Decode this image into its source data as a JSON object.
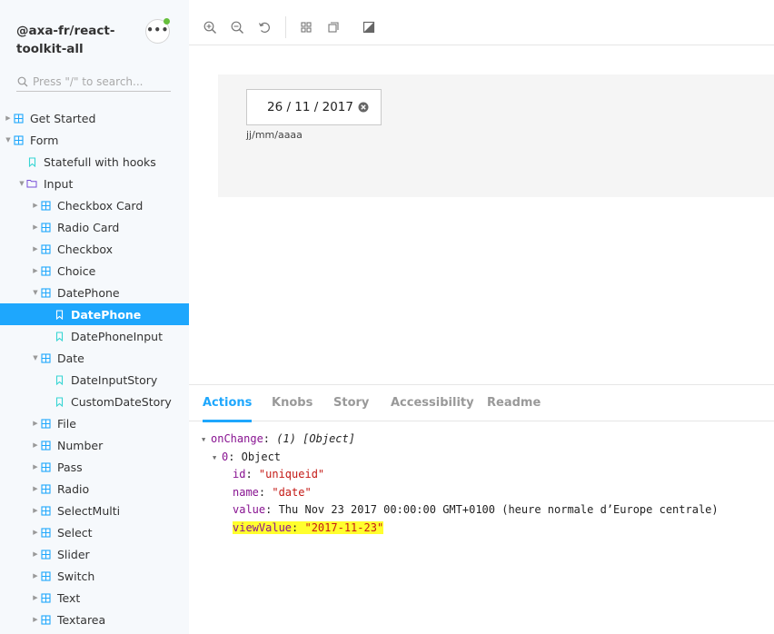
{
  "sidebar": {
    "brand": "@axa-fr/react-toolkit-all",
    "menu_label": "•••",
    "search_placeholder": "Press \"/\" to search...",
    "tree": [
      {
        "label": "Get Started",
        "level": 0,
        "type": "component",
        "expanded": false
      },
      {
        "label": "Form",
        "level": 0,
        "type": "component",
        "expanded": true
      },
      {
        "label": "Statefull with hooks",
        "level": 1,
        "type": "story"
      },
      {
        "label": "Input",
        "level": 1,
        "type": "folder",
        "expanded": true
      },
      {
        "label": "Checkbox Card",
        "level": 2,
        "type": "component",
        "expanded": false
      },
      {
        "label": "Radio Card",
        "level": 2,
        "type": "component",
        "expanded": false
      },
      {
        "label": "Checkbox",
        "level": 2,
        "type": "component",
        "expanded": false
      },
      {
        "label": "Choice",
        "level": 2,
        "type": "component",
        "expanded": false
      },
      {
        "label": "DatePhone",
        "level": 2,
        "type": "component",
        "expanded": true
      },
      {
        "label": "DatePhone",
        "level": 3,
        "type": "story",
        "selected": true
      },
      {
        "label": "DatePhoneInput",
        "level": 3,
        "type": "story"
      },
      {
        "label": "Date",
        "level": 2,
        "type": "component",
        "expanded": true
      },
      {
        "label": "DateInputStory",
        "level": 3,
        "type": "story"
      },
      {
        "label": "CustomDateStory",
        "level": 3,
        "type": "story"
      },
      {
        "label": "File",
        "level": 2,
        "type": "component",
        "expanded": false
      },
      {
        "label": "Number",
        "level": 2,
        "type": "component",
        "expanded": false
      },
      {
        "label": "Pass",
        "level": 2,
        "type": "component",
        "expanded": false
      },
      {
        "label": "Radio",
        "level": 2,
        "type": "component",
        "expanded": false
      },
      {
        "label": "SelectMulti",
        "level": 2,
        "type": "component",
        "expanded": false
      },
      {
        "label": "Select",
        "level": 2,
        "type": "component",
        "expanded": false
      },
      {
        "label": "Slider",
        "level": 2,
        "type": "component",
        "expanded": false
      },
      {
        "label": "Switch",
        "level": 2,
        "type": "component",
        "expanded": false
      },
      {
        "label": "Text",
        "level": 2,
        "type": "component",
        "expanded": false
      },
      {
        "label": "Textarea",
        "level": 2,
        "type": "component",
        "expanded": false
      }
    ]
  },
  "toolbar": {
    "icons": [
      "zoom-in-icon",
      "zoom-out-icon",
      "reset-zoom-icon",
      "grid-icon",
      "background-icon",
      "contrast-icon"
    ]
  },
  "preview": {
    "date_value": "26 / 11 / 2017",
    "date_help": "jj/mm/aaaa"
  },
  "panel": {
    "tabs": [
      {
        "label": "Actions",
        "active": true
      },
      {
        "label": "Knobs",
        "active": false
      },
      {
        "label": "Story",
        "active": false
      },
      {
        "label": "Accessibility",
        "active": false
      },
      {
        "label": "Readme",
        "active": false
      }
    ],
    "log": {
      "event": "onChange",
      "event_suffix": ": ",
      "count": "(1)",
      "summary": "[Object]",
      "index_key": "0",
      "index_type": ": Object",
      "fields": [
        {
          "key": "id",
          "value": "\"uniqueid\"",
          "kind": "string"
        },
        {
          "key": "name",
          "value": "\"date\"",
          "kind": "string"
        },
        {
          "key": "value",
          "value": "Thu Nov 23 2017 00:00:00 GMT+0100 (heure normale d’Europe centrale)",
          "kind": "plain"
        },
        {
          "key": "viewValue",
          "value": "\"2017-11-23\"",
          "kind": "string",
          "highlighted": true
        }
      ]
    }
  },
  "colors": {
    "accent": "#1ea7fd",
    "sidebar_bg": "#f6f9fc",
    "highlight": "#ffff2e",
    "notif": "#66bf3c"
  }
}
